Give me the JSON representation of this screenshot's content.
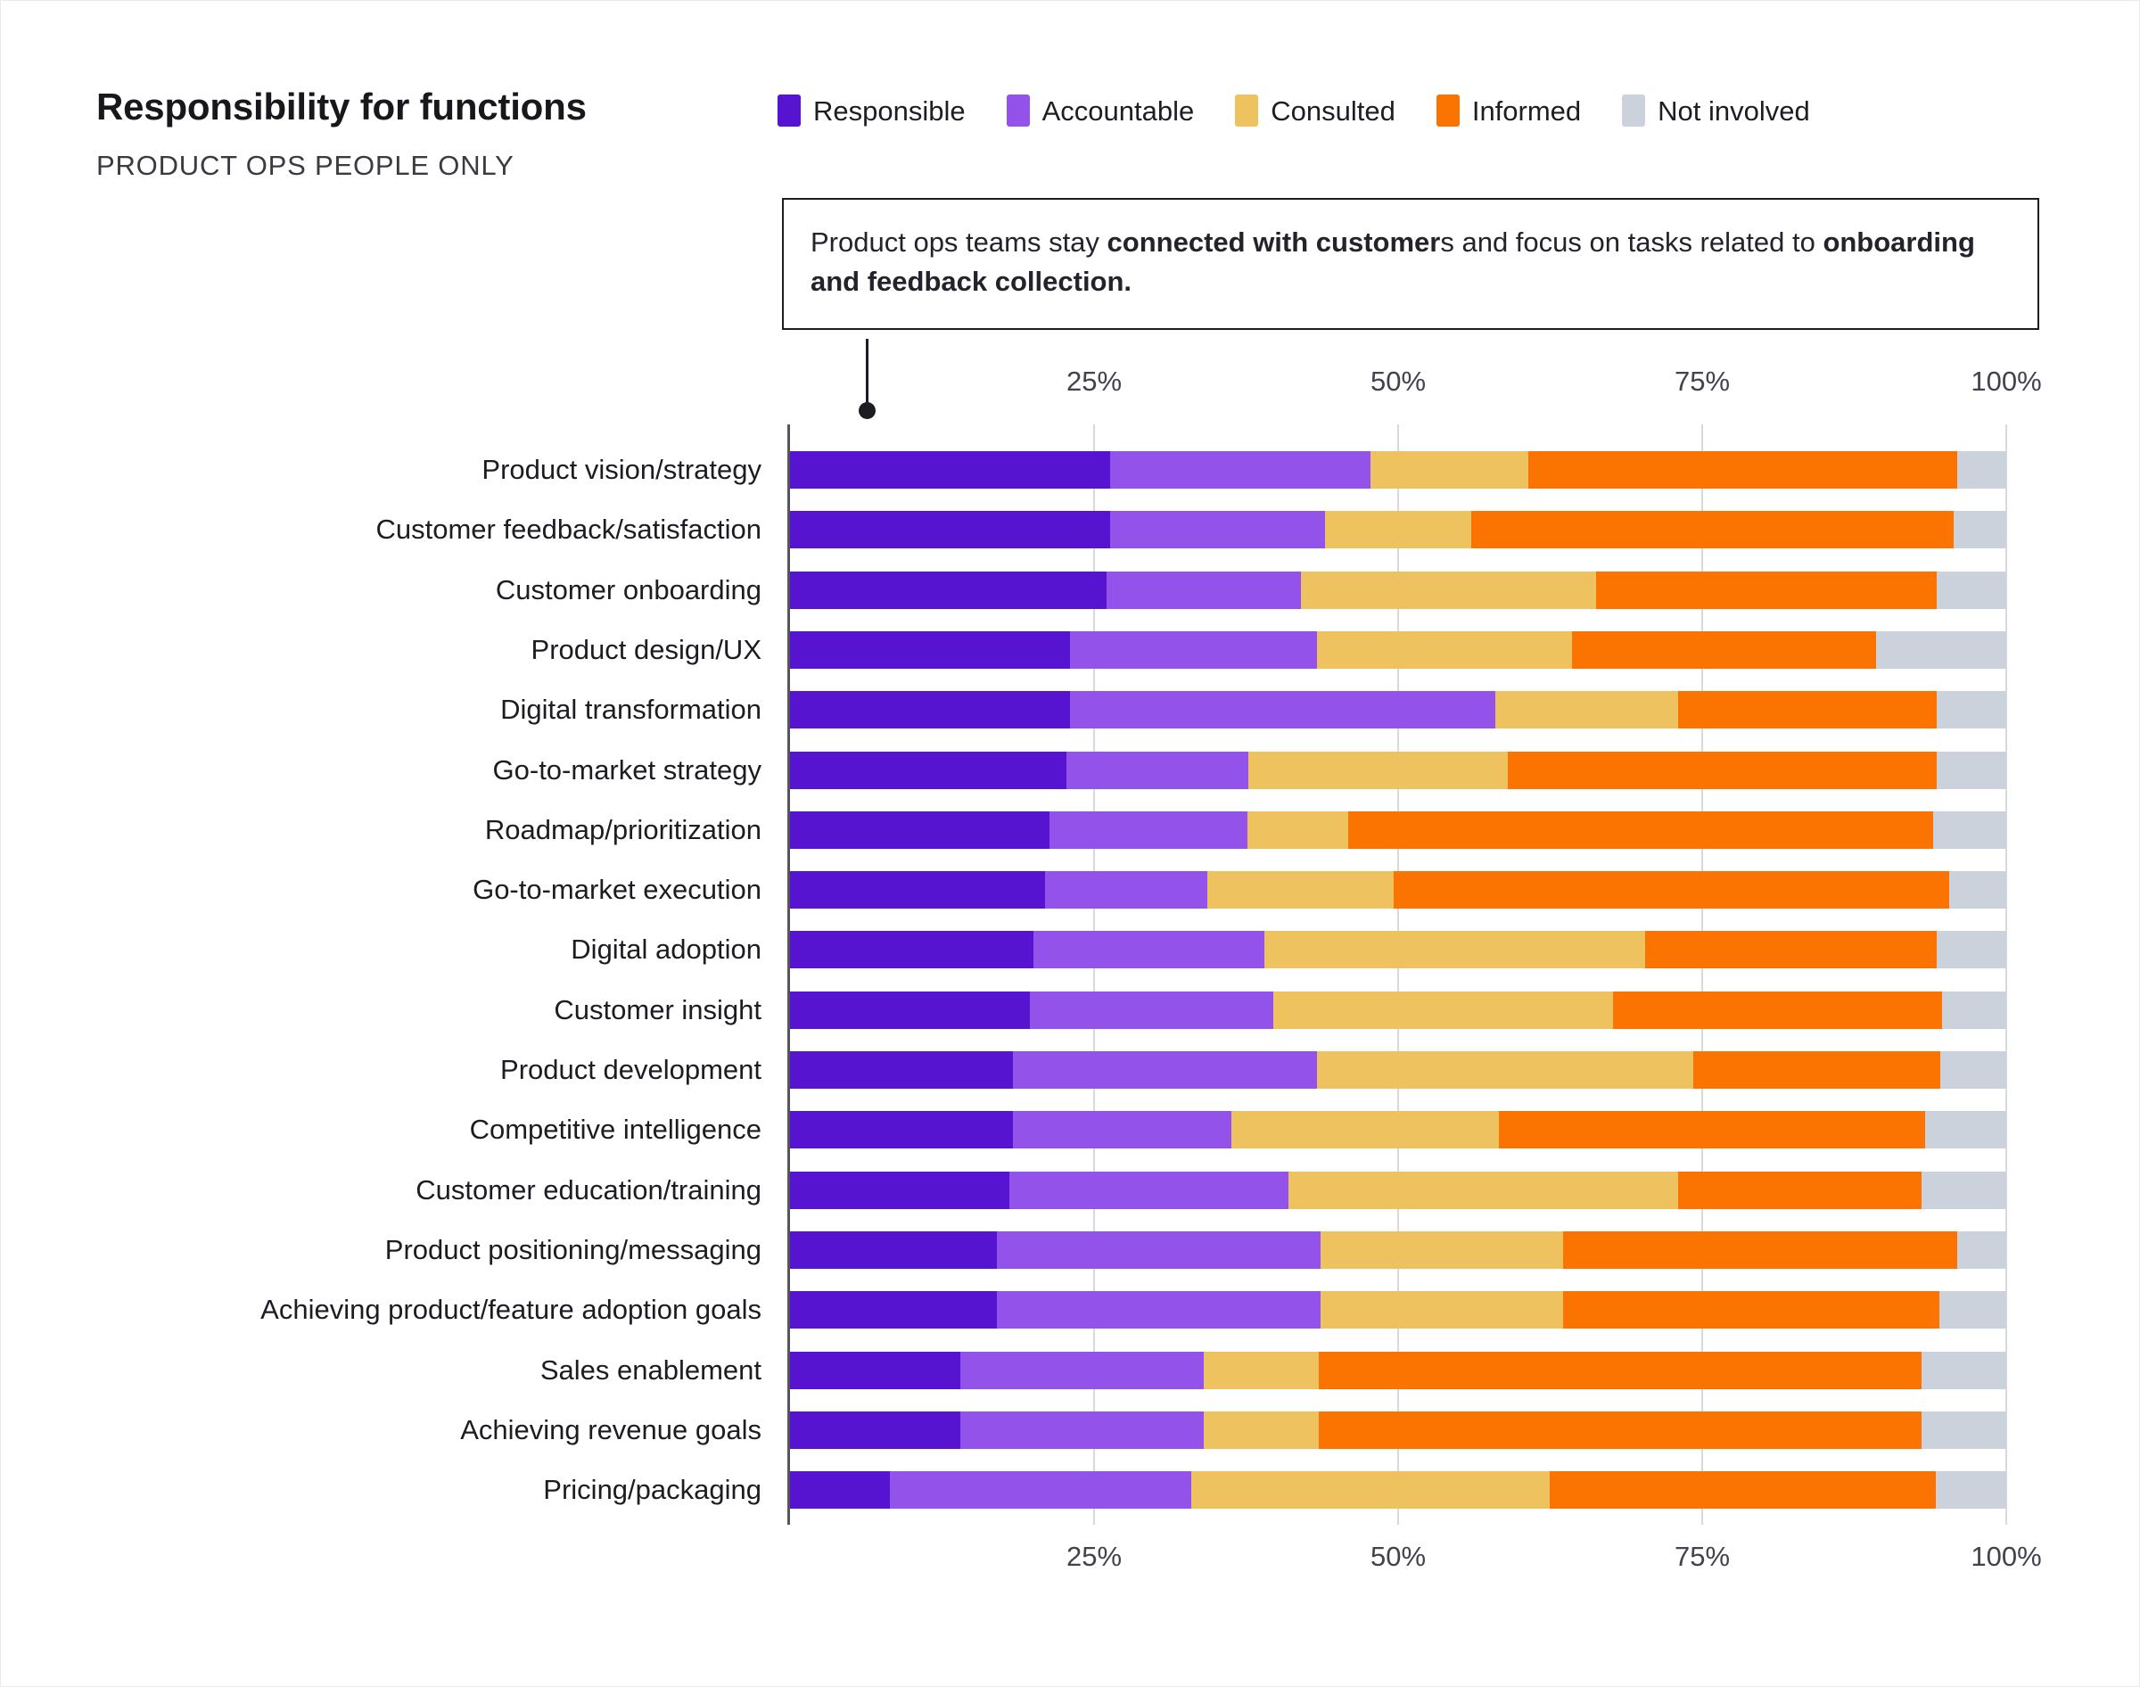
{
  "header": {
    "title": "Responsibility for functions",
    "subtitle": "PRODUCT OPS PEOPLE ONLY"
  },
  "callout": {
    "line1_a": "Product ops teams stay ",
    "line1_b": "connected with customer",
    "line1_c": "s and focus on tasks related to ",
    "line1_d": "onboarding and feedback collection."
  },
  "legend": {
    "items": [
      {
        "label": "Responsible",
        "color": "#5614d1"
      },
      {
        "label": "Accountable",
        "color": "#9352ea"
      },
      {
        "label": "Consulted",
        "color": "#eec25e"
      },
      {
        "label": "Informed",
        "color": "#fb7300"
      },
      {
        "label": "Not involved",
        "color": "#ccd2dc"
      }
    ]
  },
  "chart_data": {
    "type": "bar",
    "orientation": "horizontal",
    "stacked": true,
    "normalized_percent": true,
    "title": "Responsibility for functions",
    "subtitle": "PRODUCT OPS PEOPLE ONLY",
    "xlabel": "",
    "ylabel": "",
    "xlim": [
      0,
      100
    ],
    "grid": "vertical",
    "legend_position": "top",
    "tick_labels": [
      "25%",
      "50%",
      "75%",
      "100%"
    ],
    "tick_values": [
      25,
      50,
      75,
      100
    ],
    "series": [
      {
        "name": "Responsible",
        "color": "#5614d1"
      },
      {
        "name": "Accountable",
        "color": "#9352ea"
      },
      {
        "name": "Consulted",
        "color": "#eec25e"
      },
      {
        "name": "Informed",
        "color": "#fb7300"
      },
      {
        "name": "Not involved",
        "color": "#ccd2dc"
      }
    ],
    "categories": [
      "Product vision/strategy",
      "Customer feedback/satisfaction",
      "Customer onboarding",
      "Product design/UX",
      "Digital transformation",
      "Go-to-market strategy",
      "Roadmap/prioritization",
      "Go-to-market execution",
      "Digital adoption",
      "Customer insight",
      "Product development",
      "Competitive intelligence",
      "Customer education/training",
      "Product positioning/messaging",
      "Achieving product/feature adoption goals",
      "Sales enablement",
      "Achieving revenue goals",
      "Pricing/packaging"
    ],
    "rows": [
      {
        "category": "Product vision/strategy",
        "values": [
          26.3,
          21.4,
          13.0,
          35.3,
          4.0
        ]
      },
      {
        "category": "Customer feedback/satisfaction",
        "values": [
          26.3,
          17.7,
          12.0,
          39.7,
          4.3
        ]
      },
      {
        "category": "Customer onboarding",
        "values": [
          26.0,
          16.0,
          24.3,
          28.0,
          5.7
        ]
      },
      {
        "category": "Product design/UX",
        "values": [
          23.0,
          20.3,
          21.0,
          25.0,
          10.7
        ]
      },
      {
        "category": "Digital transformation",
        "values": [
          23.0,
          35.0,
          15.0,
          21.3,
          5.7
        ]
      },
      {
        "category": "Go-to-market strategy",
        "values": [
          22.7,
          15.0,
          21.3,
          35.3,
          5.7
        ]
      },
      {
        "category": "Roadmap/prioritization",
        "values": [
          21.3,
          16.3,
          8.3,
          48.1,
          6.0
        ]
      },
      {
        "category": "Go-to-market execution",
        "values": [
          21.0,
          13.3,
          15.3,
          45.7,
          4.7
        ]
      },
      {
        "category": "Digital adoption",
        "values": [
          20.0,
          19.0,
          31.3,
          24.0,
          5.7
        ]
      },
      {
        "category": "Customer insight",
        "values": [
          19.7,
          20.0,
          28.0,
          27.0,
          5.3
        ]
      },
      {
        "category": "Product development",
        "values": [
          18.3,
          25.0,
          31.0,
          20.3,
          5.4
        ]
      },
      {
        "category": "Competitive intelligence",
        "values": [
          18.3,
          18.0,
          22.0,
          35.0,
          6.7
        ]
      },
      {
        "category": "Customer education/training",
        "values": [
          18.0,
          23.0,
          32.0,
          20.0,
          7.0
        ]
      },
      {
        "category": "Product positioning/messaging",
        "values": [
          17.0,
          26.6,
          20.0,
          32.4,
          4.0
        ]
      },
      {
        "category": "Achieving product/feature adoption goals",
        "values": [
          17.0,
          26.6,
          20.0,
          30.9,
          5.5
        ]
      },
      {
        "category": "Sales enablement",
        "values": [
          14.0,
          20.0,
          9.5,
          49.5,
          7.0
        ]
      },
      {
        "category": "Achieving revenue goals",
        "values": [
          14.0,
          20.0,
          9.5,
          49.5,
          7.0
        ]
      },
      {
        "category": "Pricing/packaging",
        "values": [
          8.2,
          24.8,
          29.5,
          31.7,
          5.8
        ]
      }
    ]
  }
}
